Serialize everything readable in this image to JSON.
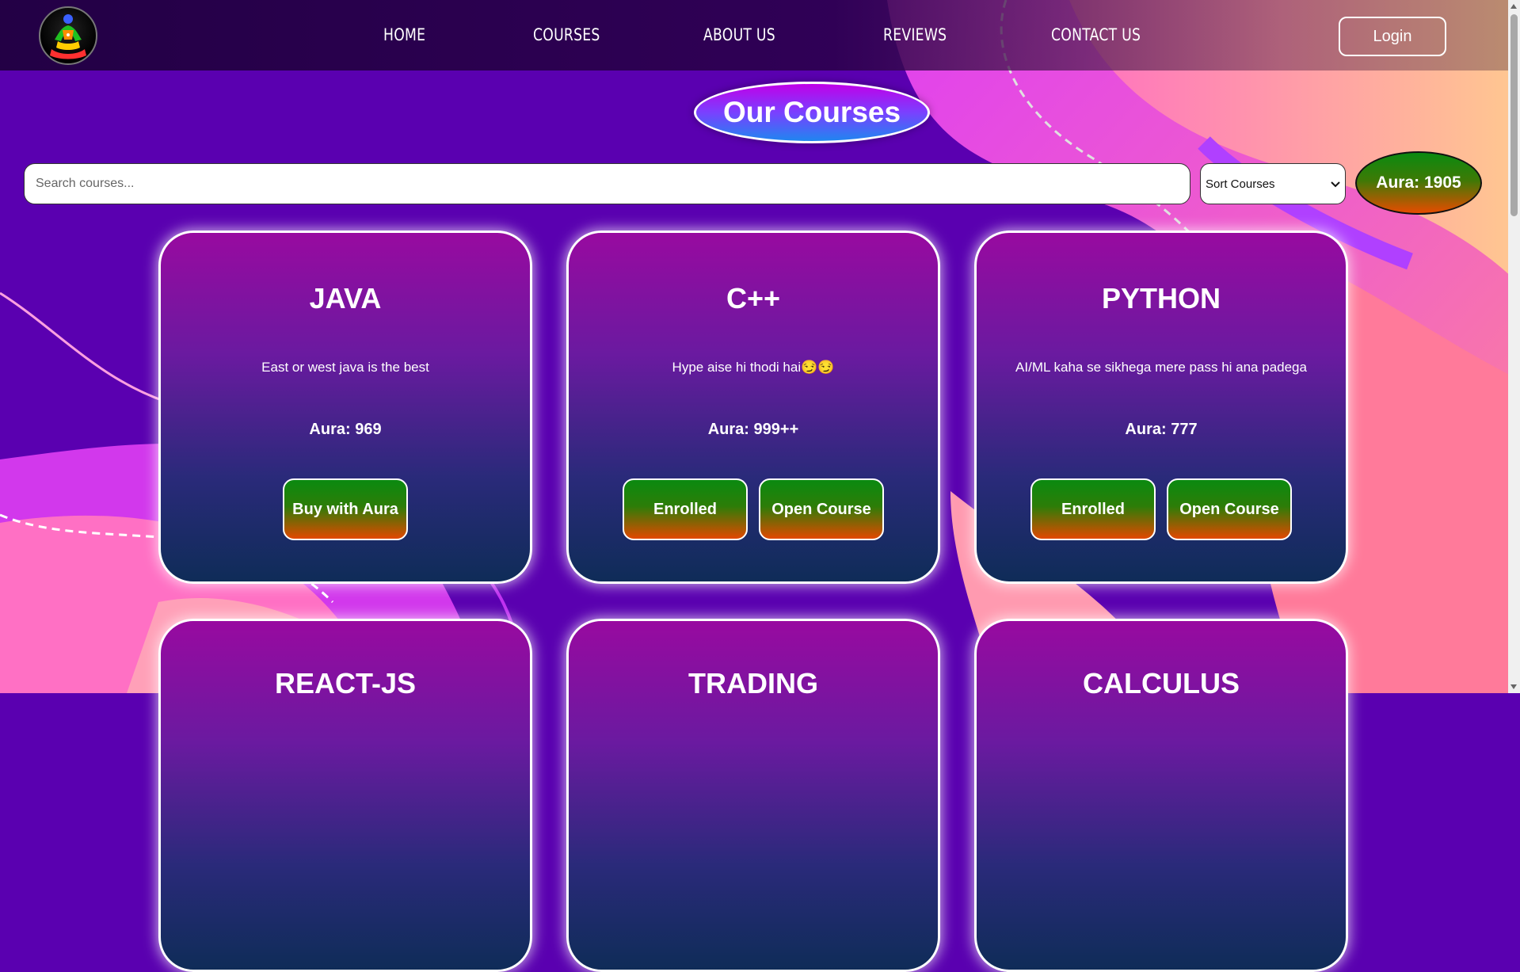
{
  "nav": {
    "links": [
      "HOME",
      "COURSES",
      "ABOUT US",
      "REVIEWS",
      "CONTACT US"
    ],
    "login": "Login"
  },
  "page": {
    "title": "Our Courses"
  },
  "search": {
    "placeholder": "Search courses...",
    "sort_label": "Sort Courses"
  },
  "user": {
    "aura": "Aura: 1905"
  },
  "courses": [
    {
      "title": "JAVA",
      "desc": "East or west java is the best",
      "aura": "Aura: 969",
      "buttons": [
        "Buy with Aura"
      ]
    },
    {
      "title": "C++",
      "desc": "Hype aise hi thodi hai😏😏",
      "aura": "Aura: 999++",
      "buttons": [
        "Enrolled",
        "Open Course"
      ]
    },
    {
      "title": "PYTHON",
      "desc": "AI/ML kaha se sikhega mere pass hi ana padega",
      "aura": "Aura: 777",
      "buttons": [
        "Enrolled",
        "Open Course"
      ]
    },
    {
      "title": "REACT-JS"
    },
    {
      "title": "TRADING"
    },
    {
      "title": "CALCULUS"
    }
  ],
  "colors": {
    "background": "#5a00b0",
    "button_gradient_top": "#0a8a10",
    "button_gradient_bottom": "#e24800",
    "title_pill_top": "#c000e8",
    "title_pill_bottom": "#1f86f0"
  },
  "icons": [
    "logo-meditation-icon",
    "chevron-down-icon"
  ]
}
